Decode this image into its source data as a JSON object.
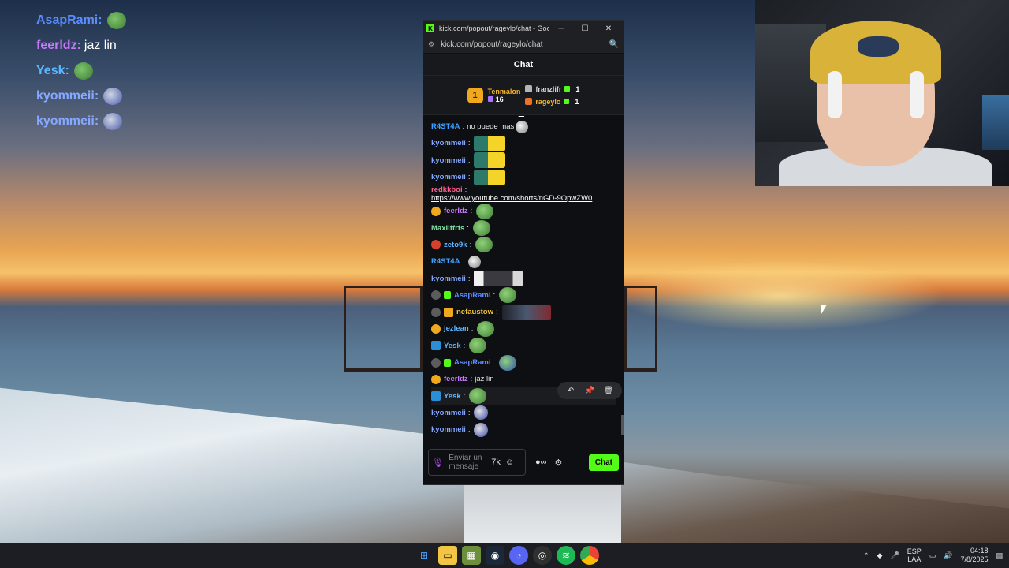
{
  "overlay_chat": [
    {
      "user": "AsapRami",
      "color": "#5b8cff",
      "text": "",
      "emote": "pepe"
    },
    {
      "user": "feerldz",
      "color": "#c977ff",
      "text": "jaz lin",
      "emote": ""
    },
    {
      "user": "Yesk",
      "color": "#5eb6ff",
      "text": "",
      "emote": "pepe"
    },
    {
      "user": "kyommeii",
      "color": "#86a8ff",
      "text": "",
      "emote": "blue"
    },
    {
      "user": "kyommeii",
      "color": "#86a8ff",
      "text": "",
      "emote": "blue"
    }
  ],
  "window": {
    "title": "kick.com/popout/rageylo/chat - Google...",
    "url": "kick.com/popout/rageylo/chat",
    "controls": [
      "─",
      "☐",
      "✕"
    ]
  },
  "chat": {
    "header": "Chat",
    "leaderboard": {
      "first": {
        "rank": "1",
        "name": "Tenmalon",
        "count": "16"
      },
      "others": [
        {
          "name": "franzlifr",
          "count": "1"
        },
        {
          "name": "rageylo",
          "count": "1"
        }
      ]
    },
    "messages": [
      {
        "user": "R4ST4A",
        "color": "#3fa0ff",
        "text": "no puede mas",
        "emote": "mask",
        "badges": []
      },
      {
        "user": "kyommeii",
        "color": "#86a8ff",
        "text": "",
        "emote": "pika",
        "badges": []
      },
      {
        "user": "kyommeii",
        "color": "#86a8ff",
        "text": "",
        "emote": "pika",
        "badges": []
      },
      {
        "user": "kyommeii",
        "color": "#86a8ff",
        "text": "",
        "emote": "pika",
        "badges": []
      },
      {
        "user": "redkkboi",
        "color": "#ff5f8f",
        "text": "https://www.youtube.com/shorts/nGD-9OpwZW0",
        "emote": "",
        "link": true,
        "badges": []
      },
      {
        "user": "feerldz",
        "color": "#c977ff",
        "text": "",
        "emote": "pepe",
        "badges": [
          "gold"
        ]
      },
      {
        "user": "Maxiiffrfs",
        "color": "#7fe0a0",
        "text": "",
        "emote": "pepe",
        "badges": []
      },
      {
        "user": "zeto9k",
        "color": "#5eb6ff",
        "text": "",
        "emote": "pepe",
        "badges": [
          "red"
        ]
      },
      {
        "user": "R4ST4A",
        "color": "#3fa0ff",
        "text": "",
        "emote": "mask",
        "badges": []
      },
      {
        "user": "kyommeii",
        "color": "#86a8ff",
        "text": "",
        "emote": "clip",
        "badges": []
      },
      {
        "user": "AsapRami",
        "color": "#5b8cff",
        "text": "",
        "emote": "pepe",
        "badges": [
          "skull",
          "green"
        ]
      },
      {
        "user": "nefaustow",
        "color": "#f0c23a",
        "text": "",
        "emote": "clip2",
        "badges": [
          "skull",
          "orange"
        ]
      },
      {
        "user": "jezlean",
        "color": "#5eb6ff",
        "text": "",
        "emote": "pepe",
        "badges": [
          "gold"
        ]
      },
      {
        "user": "Yesk",
        "color": "#5eb6ff",
        "text": "",
        "emote": "pepe",
        "badges": [
          "cyan"
        ]
      },
      {
        "user": "AsapRami",
        "color": "#5b8cff",
        "text": "",
        "emote": "pepe-blue",
        "badges": [
          "skull",
          "green"
        ]
      },
      {
        "user": "feerldz",
        "color": "#c977ff",
        "text": "jaz lin",
        "emote": "",
        "badges": [
          "gold"
        ]
      },
      {
        "user": "Yesk",
        "color": "#5eb6ff",
        "text": "",
        "emote": "pepe",
        "badges": [
          "cyan"
        ],
        "hover": true
      },
      {
        "user": "kyommeii",
        "color": "#86a8ff",
        "text": "",
        "emote": "small",
        "badges": []
      },
      {
        "user": "kyommeii",
        "color": "#86a8ff",
        "text": "",
        "emote": "small",
        "badges": []
      }
    ],
    "composer": {
      "placeholder": "Enviar un mensaje",
      "send_label": "Chat"
    }
  },
  "taskbar": {
    "apps": [
      "windows-start",
      "file-explorer",
      "minecraft",
      "steam",
      "discord",
      "obs",
      "spotify",
      "chrome"
    ],
    "lang_top": "ESP",
    "lang_bottom": "LAA",
    "time": "04:18",
    "date": "7/8/2025"
  },
  "colors": {
    "kick_green": "#53fc18",
    "chat_bg": "#0e0f12",
    "gold": "#f0a81e"
  }
}
